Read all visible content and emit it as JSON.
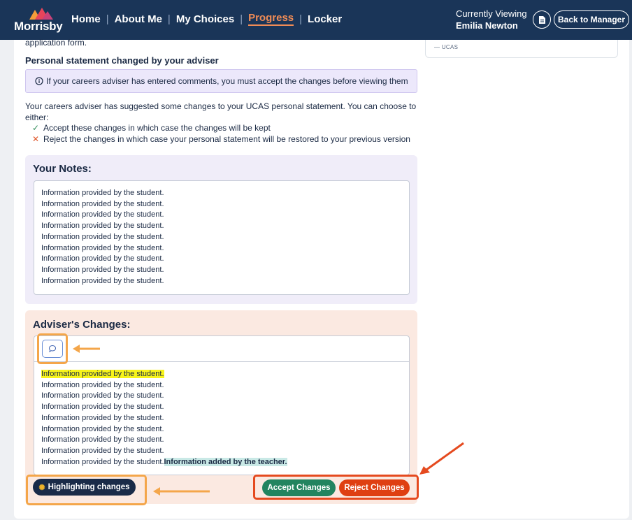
{
  "header": {
    "logo_text": "Morrisby",
    "nav": [
      {
        "label": "Home",
        "active": false
      },
      {
        "label": "About Me",
        "active": false
      },
      {
        "label": "My Choices",
        "active": false
      },
      {
        "label": "Progress",
        "active": true
      },
      {
        "label": "Locker",
        "active": false
      }
    ],
    "viewing_label": "Currently Viewing",
    "viewing_name": "Emilia Newton",
    "back_label": "Back to Manager"
  },
  "side_card": {
    "caption": "— UCAS"
  },
  "content": {
    "top_cut_text": "application form.",
    "section_title": "Personal statement changed by your adviser",
    "info_text": "If your careers adviser has entered comments, you must accept the changes before viewing them",
    "intro": "Your careers adviser has suggested some changes to your UCAS personal statement. You can choose to either:",
    "option_accept": "Accept these changes in which case the changes will be kept",
    "option_reject": "Reject the changes in which case your personal statement will be restored to your previous version"
  },
  "notes": {
    "title": "Your Notes:",
    "lines": [
      "Information provided by the student.",
      "Information provided by the student.",
      "Information provided by the student.",
      "Information provided by the student.",
      "Information provided by the student.",
      "Information provided by the student.",
      "Information provided by the student.",
      "Information provided by the student.",
      "Information provided by the student."
    ]
  },
  "adviser": {
    "title": "Adviser's Changes:",
    "first_line": "Information provided by the student.",
    "lines": [
      "Information provided by the student.",
      "Information provided by the student.",
      "Information provided by the student.",
      "Information provided by the student.",
      "Information provided by the student.",
      "Information provided by the student.",
      "Information provided by the student."
    ],
    "last_line": "Information provided by the student.",
    "added_text": "Information added by the teacher."
  },
  "actions": {
    "highlighting_label": "Highlighting changes",
    "accept_label": "Accept Changes",
    "reject_label": "Reject Changes"
  },
  "colors": {
    "header_bg": "#1a3558",
    "active_nav": "#f08c56",
    "accept": "#22845f",
    "reject": "#df3f12",
    "annotation_orange": "#f4a64a",
    "annotation_red": "#e54a1f"
  }
}
